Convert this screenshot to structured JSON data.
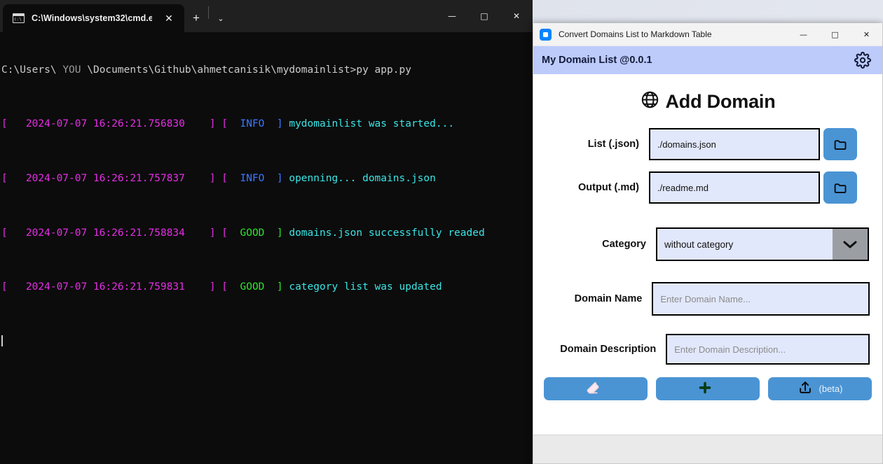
{
  "terminal": {
    "tab_title": "C:\\Windows\\system32\\cmd.e:",
    "tab_icon": "cmd-icon",
    "new_tab_glyph": "+",
    "dropdown_glyph": "⌄",
    "close_glyph": "✕",
    "window_controls": {
      "minimize": "—",
      "maximize": "□",
      "close": "✕"
    },
    "prompt": {
      "prefix": "C:\\Users\\ ",
      "user": "YOU",
      "suffix": " \\Documents\\Github\\ahmetcanisik\\mydomainlist>",
      "command": "py app.py"
    },
    "log_lines": [
      {
        "open": "[",
        "timestamp": "   2024-07-07 16:26:21.756830    ",
        "close": "] [",
        "level": "  INFO  ",
        "close2": "] ",
        "message": "mydomainlist was started...",
        "level_color": "blue"
      },
      {
        "open": "[",
        "timestamp": "   2024-07-07 16:26:21.757837    ",
        "close": "] [",
        "level": "  INFO  ",
        "close2": "] ",
        "message": "openning... domains.json",
        "level_color": "blue"
      },
      {
        "open": "[",
        "timestamp": "   2024-07-07 16:26:21.758834    ",
        "close": "] [",
        "level": "  GOOD  ",
        "close2": "] ",
        "message": "domains.json successfully readed",
        "level_color": "green"
      },
      {
        "open": "[",
        "timestamp": "   2024-07-07 16:26:21.759831    ",
        "close": "] [",
        "level": "  GOOD  ",
        "close2": "] ",
        "message": "category list was updated",
        "level_color": "green"
      }
    ]
  },
  "app": {
    "window_title": "Convert Domains List to Markdown Table",
    "window_controls": {
      "minimize": "—",
      "maximize": "□",
      "close": "✕"
    },
    "header": {
      "title": "My Domain List @0.0.1",
      "settings_icon": "gear-icon"
    },
    "page_heading": {
      "icon": "globe-icon",
      "text": "Add Domain"
    },
    "form": {
      "list": {
        "label": "List (.json)",
        "value": "./domains.json",
        "browse_icon": "folder-icon"
      },
      "output": {
        "label": "Output (.md)",
        "value": "./readme.md",
        "browse_icon": "folder-icon"
      },
      "category": {
        "label": "Category",
        "value": "without category",
        "arrow_icon": "chevron-down-icon"
      },
      "domain_name": {
        "label": "Domain Name",
        "value": "",
        "placeholder": "Enter Domain Name..."
      },
      "domain_description": {
        "label": "Domain Description",
        "value": "",
        "placeholder": "Enter Domain Description..."
      }
    },
    "buttons": [
      {
        "name": "clear-button",
        "icon": "eraser-icon",
        "label": ""
      },
      {
        "name": "add-button",
        "icon": "plus-icon",
        "label": ""
      },
      {
        "name": "upload-button",
        "icon": "upload-icon",
        "label": "(beta)"
      }
    ],
    "colors": {
      "header_bg": "#bdcbfb",
      "accent_blue": "#4a94d4",
      "input_bg": "#e2e8fb",
      "combo_arrow_bg": "#9b9ea3"
    }
  }
}
